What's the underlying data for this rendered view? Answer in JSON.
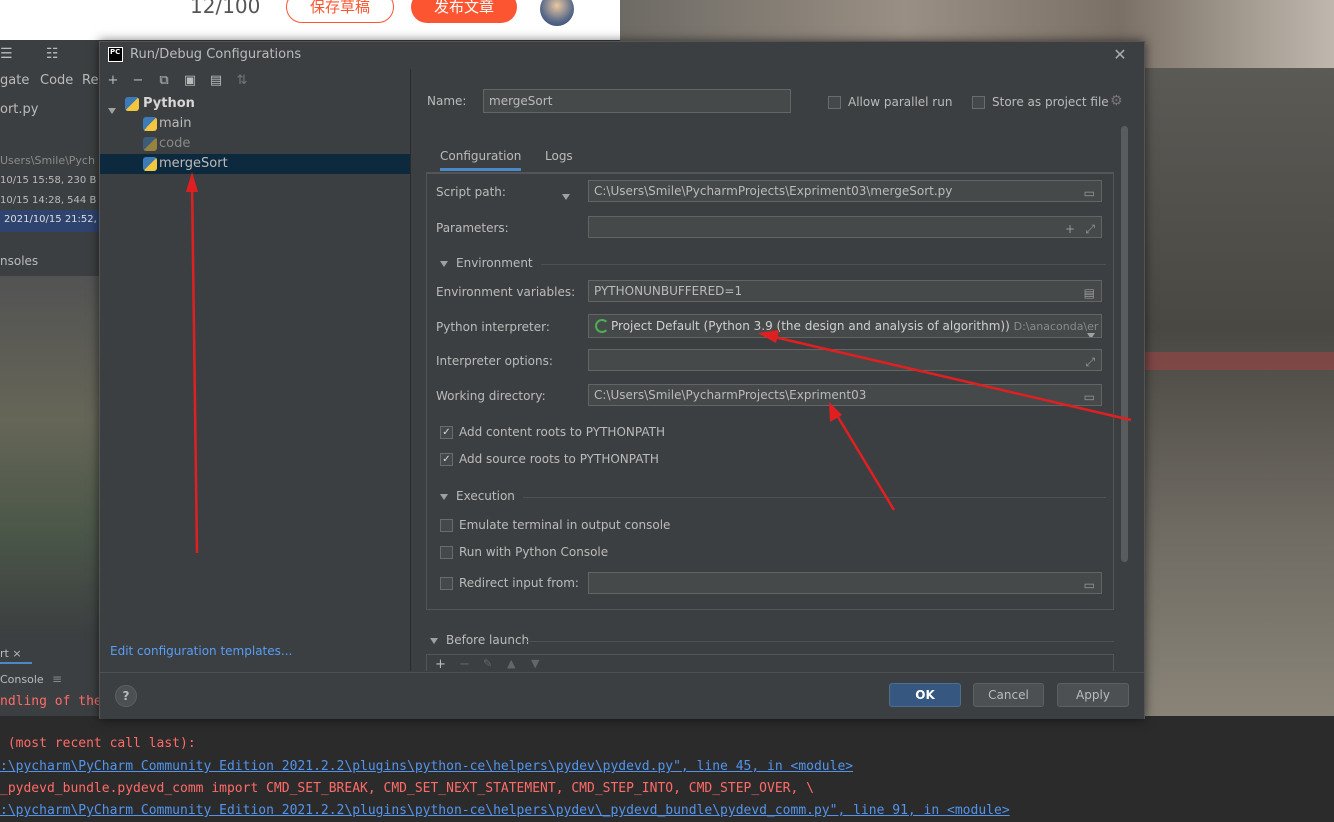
{
  "web": {
    "counter": "12/100",
    "save_draft": "保存草稿",
    "publish": "发布文章"
  },
  "ide": {
    "menu_items": [
      "gate",
      "Code",
      "Re"
    ],
    "project_items": [
      "ort.py",
      "Users\\Smile\\Pych",
      "10/15 15:58, 230 B",
      "10/15 14:28, 544 B",
      "2021/10/15 21:52,",
      "nsoles"
    ],
    "run_tab": "rt ×",
    "console_tab": "Console"
  },
  "console": {
    "lines": [
      "ndling of the",
      "",
      " (most recent call last):",
      ":\\pycharm\\PyCharm Community Edition 2021.2.2\\plugins\\python-ce\\helpers\\pydev\\pydevd.py\", line 45, in <module>",
      "_pydevd_bundle.pydevd_comm import CMD_SET_BREAK, CMD_SET_NEXT_STATEMENT, CMD_STEP_INTO, CMD_STEP_OVER, \\",
      ":\\pycharm\\PyCharm Community Edition 2021.2.2\\plugins\\python-ce\\helpers\\pydev\\_pydevd_bundle\\pydevd_comm.py\", line 91, in <module>"
    ]
  },
  "dialog": {
    "title": "Run/Debug Configurations",
    "logo": "PC",
    "tree": {
      "group": "Python",
      "items": [
        "main",
        "code",
        "mergeSort"
      ]
    },
    "edit_templates": "Edit configuration templates...",
    "name_label": "Name:",
    "name_value": "mergeSort",
    "allow_parallel": "Allow parallel run",
    "store_project": "Store as project file",
    "tabs": [
      "Configuration",
      "Logs"
    ],
    "script_path_label": "Script path:",
    "script_path": "C:\\Users\\Smile\\PycharmProjects\\Expriment03\\mergeSort.py",
    "parameters_label": "Parameters:",
    "environment_section": "Environment",
    "env_vars_label": "Environment variables:",
    "env_vars": "PYTHONUNBUFFERED=1",
    "interpreter_label": "Python interpreter:",
    "interpreter": "Project Default (Python 3.9 (the design and analysis of algorithm))",
    "interpreter_path": "D:\\anaconda\\er",
    "interp_options_label": "Interpreter options:",
    "workdir_label": "Working directory:",
    "workdir": "C:\\Users\\Smile\\PycharmProjects\\Expriment03",
    "add_content_roots": "Add content roots to PYTHONPATH",
    "add_source_roots": "Add source roots to PYTHONPATH",
    "execution_section": "Execution",
    "emulate_terminal": "Emulate terminal in output console",
    "run_python_console": "Run with Python Console",
    "redirect_input": "Redirect input from:",
    "before_launch": "Before launch",
    "ok": "OK",
    "cancel": "Cancel",
    "apply": "Apply",
    "help": "?"
  },
  "colors": {
    "accent": "#365880",
    "link": "#589df6",
    "selection": "#0d293e",
    "arrow": "#e02020",
    "brand_orange": "#fc5531"
  }
}
